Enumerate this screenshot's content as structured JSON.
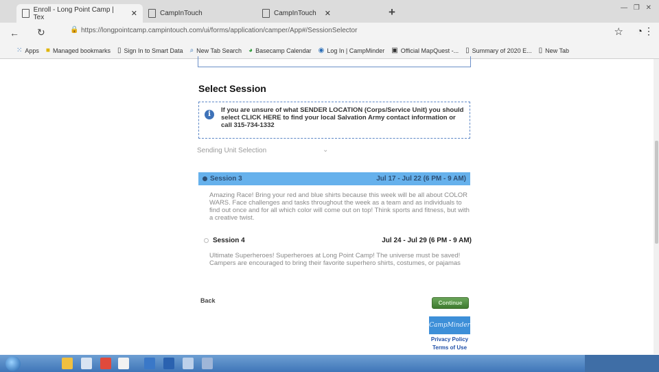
{
  "browser": {
    "tabs": [
      {
        "label": "Enroll - Long Point Camp | Tex",
        "active": true
      },
      {
        "label": "CampInTouch",
        "active": false
      },
      {
        "label": "CampInTouch",
        "active": false
      }
    ],
    "url": "https://longpointcamp.campintouch.com/ui/forms/application/camper/App#/SessionSelector",
    "bookmarks": [
      {
        "label": "Apps",
        "icon": "apps-grid-icon"
      },
      {
        "label": "Managed bookmarks",
        "icon": "folder-icon"
      },
      {
        "label": "Sign In to Smart Data",
        "icon": "page-icon"
      },
      {
        "label": "New Tab Search",
        "icon": "search-icon"
      },
      {
        "label": "Basecamp Calendar",
        "icon": "basecamp-icon"
      },
      {
        "label": "Log In | CampMinder",
        "icon": "campminder-icon"
      },
      {
        "label": "Official MapQuest -...",
        "icon": "mapquest-icon"
      },
      {
        "label": "Summary of 2020 E...",
        "icon": "page-icon"
      },
      {
        "label": "New Tab",
        "icon": "page-icon"
      }
    ]
  },
  "page": {
    "title": "Select Session",
    "info_text": "If you are unsure of what SENDER LOCATION (Corps/Service Unit) you should select CLICK HERE to find your local Salvation Army contact information or call 315-734-1332",
    "sending_unit_label": "Sending Unit Selection",
    "sessions": [
      {
        "name": "Session 3",
        "dates": "Jul 17 - Jul 22 (6 PM - 9 AM)",
        "selected": true,
        "description": "Amazing Race! Bring your red and blue shirts because this week will be all about COLOR WARS. Face challenges and tasks throughout the week as a team and as individuals to find out once and for all which color will come out on top! Think sports and fitness, but with a creative twist."
      },
      {
        "name": "Session 4",
        "dates": "Jul 24 - Jul 29 (6 PM - 9 AM)",
        "selected": false,
        "description": "Ultimate Superheroes! Superheroes at Long Point Camp! The universe must be saved! Campers are encouraged to bring their favorite superhero shirts, costumes, or pajamas"
      }
    ],
    "back_label": "Back",
    "next_label": "Continue",
    "logo_text": "CampMinder",
    "privacy_label": "Privacy Policy",
    "terms_label": "Terms of Use"
  },
  "colors": {
    "selected_session_bg": "#66b1ec",
    "link_blue": "#1f4fa8",
    "taskbar": "#4f86c6"
  }
}
